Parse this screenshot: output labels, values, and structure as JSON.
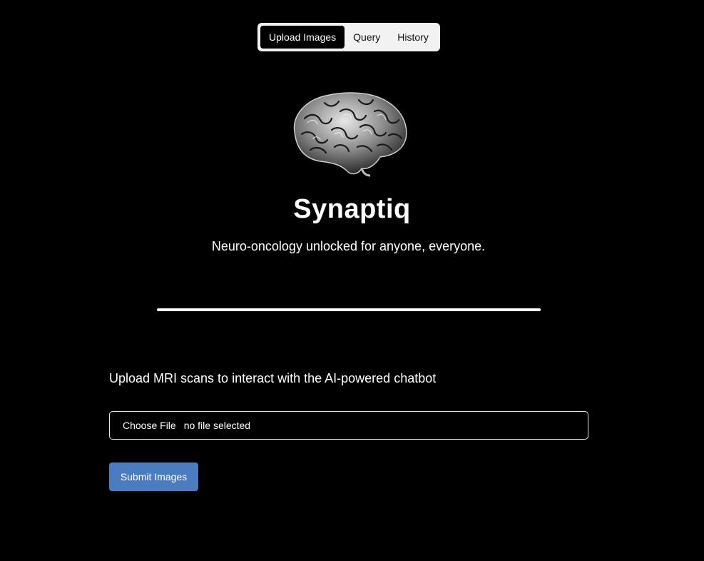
{
  "nav": {
    "tabs": [
      {
        "label": "Upload Images",
        "active": true
      },
      {
        "label": "Query",
        "active": false
      },
      {
        "label": "History",
        "active": false
      }
    ]
  },
  "hero": {
    "logo_icon": "brain-icon",
    "title": "Synaptiq",
    "tagline": "Neuro-oncology unlocked for anyone, everyone."
  },
  "upload": {
    "label": "Upload MRI scans to interact with the AI-powered chatbot",
    "choose_file_label": "Choose File",
    "file_status": "no file selected",
    "submit_label": "Submit Images"
  },
  "colors": {
    "background": "#000000",
    "submit_button": "#4a7cc2",
    "tab_bar": "#f2f2f2"
  }
}
